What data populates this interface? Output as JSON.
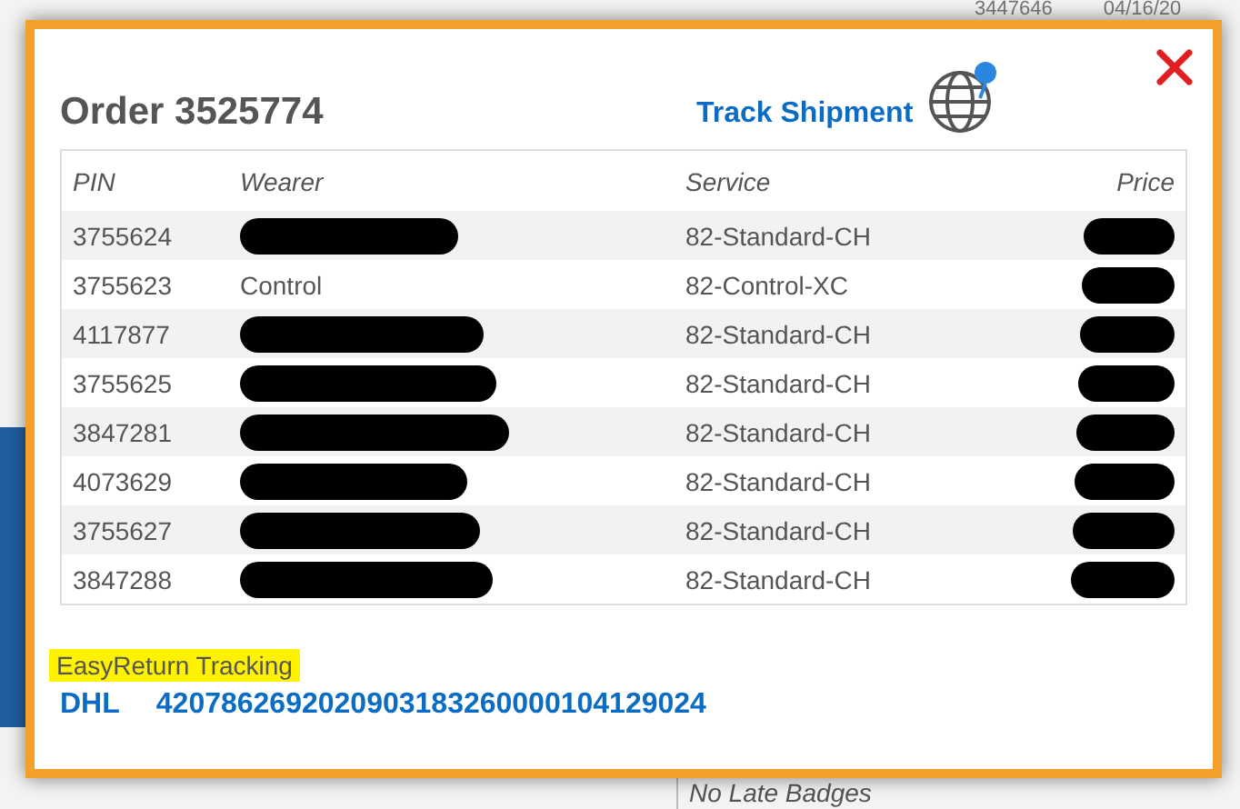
{
  "background": {
    "cells": [
      "3447646",
      "04/16/20"
    ],
    "note": "No Late Badges"
  },
  "dialog": {
    "title": "Order 3525774",
    "track_link": "Track Shipment",
    "table": {
      "columns": [
        "PIN",
        "Wearer",
        "Service",
        "Price"
      ],
      "rows": [
        {
          "pin": "3755624",
          "wearer_redacted": true,
          "service": "82-Standard-CH",
          "price_redacted": true
        },
        {
          "pin": "3755623",
          "wearer": "Control",
          "wearer_redacted": false,
          "service": "82-Control-XC",
          "price_redacted": true
        },
        {
          "pin": "4117877",
          "wearer_redacted": true,
          "service": "82-Standard-CH",
          "price_redacted": true
        },
        {
          "pin": "3755625",
          "wearer_redacted": true,
          "service": "82-Standard-CH",
          "price_redacted": true
        },
        {
          "pin": "3847281",
          "wearer_redacted": true,
          "service": "82-Standard-CH",
          "price_redacted": true
        },
        {
          "pin": "4073629",
          "wearer_redacted": true,
          "service": "82-Standard-CH",
          "price_redacted": true
        },
        {
          "pin": "3755627",
          "wearer_redacted": true,
          "service": "82-Standard-CH",
          "price_redacted": true
        },
        {
          "pin": "3847288",
          "wearer_redacted": true,
          "service": "82-Standard-CH",
          "price_redacted": true
        }
      ]
    },
    "return_label": "EasyReturn Tracking",
    "carrier": "DHL",
    "tracking_number": "4207862692020903183260000104129024"
  }
}
